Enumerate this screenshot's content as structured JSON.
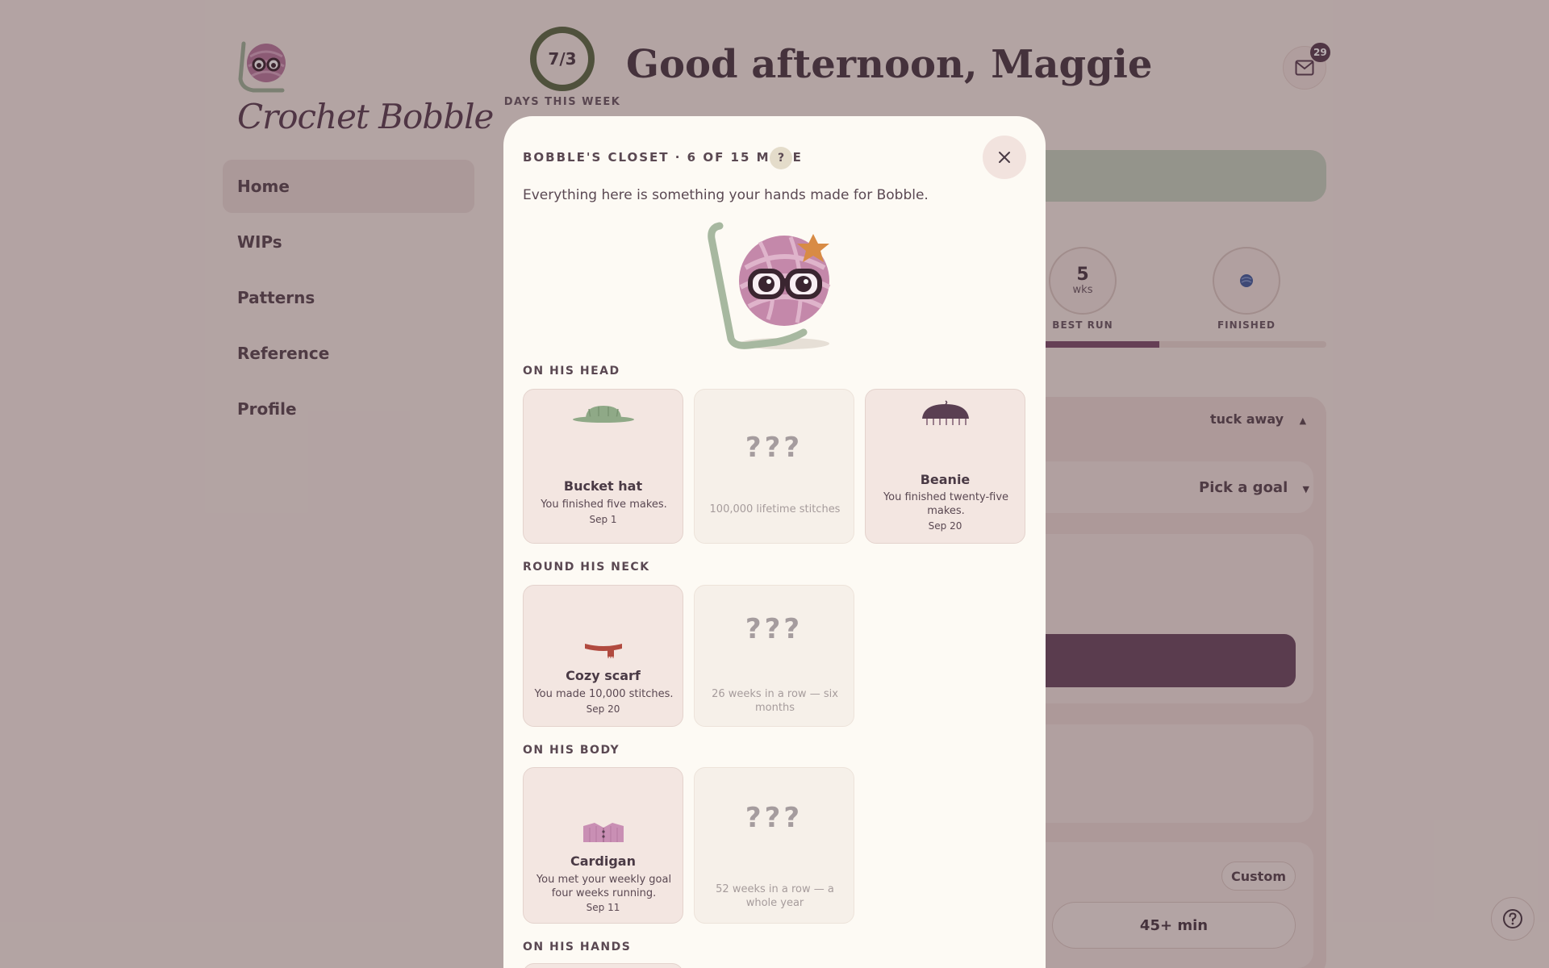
{
  "brand": {
    "name": "Crochet Bobble",
    "logo_icon": "yarn-ball-glasses-icon"
  },
  "nav": {
    "items": [
      {
        "label": "Home",
        "active": true
      },
      {
        "label": "WIPs"
      },
      {
        "label": "Patterns"
      },
      {
        "label": "Reference"
      },
      {
        "label": "Profile"
      }
    ]
  },
  "header": {
    "days_ring": {
      "text": "7/3",
      "label": "DAYS THIS WEEK"
    },
    "greeting": "Good afternoon, Maggie",
    "mail": {
      "icon": "mail-icon",
      "badge": "29"
    }
  },
  "background": {
    "best_run": {
      "value": "5",
      "unit": "wks",
      "label": "BEST RUN"
    },
    "finished": {
      "label": "FINISHED",
      "icon": "yarn-ball-icon"
    },
    "progress_fraction": 0.5,
    "tuck_away": "tuck away",
    "tuck_icon": "caret-up-icon",
    "pick_goal": "Pick a goal",
    "pick_icon": "caret-down-icon",
    "custom": "Custom",
    "min_option": "45+ min",
    "help_icon": "help-circle-icon"
  },
  "closet": {
    "title": "BOBBLE'S CLOSET · 6 OF 15 MADE",
    "help": "?",
    "close_icon": "close-icon",
    "subtitle": "Everything here is something your hands made for Bobble.",
    "sections": {
      "head": {
        "label": "ON HIS HEAD",
        "items": [
          {
            "name": "Bucket hat",
            "desc": "You finished five makes.",
            "date": "Sep 1",
            "icon": "bucket-hat-icon"
          },
          {
            "locked": "???",
            "hint": "100,000 lifetime stitches"
          },
          {
            "name": "Beanie",
            "desc": "You finished twenty-five makes.",
            "date": "Sep 20",
            "icon": "beanie-icon"
          }
        ]
      },
      "neck": {
        "label": "ROUND HIS NECK",
        "items": [
          {
            "name": "Cozy scarf",
            "desc": "You made 10,000 stitches.",
            "date": "Sep 20",
            "icon": "scarf-icon"
          },
          {
            "locked": "???",
            "hint": "26 weeks in a row — six months"
          }
        ]
      },
      "body": {
        "label": "ON HIS BODY",
        "items": [
          {
            "name": "Cardigan",
            "desc": "You met your weekly goal four weeks running.",
            "date": "Sep 11",
            "icon": "cardigan-icon"
          },
          {
            "locked": "???",
            "hint": "52 weeks in a row — a whole year"
          }
        ]
      },
      "hands": {
        "label": "ON HIS HANDS"
      }
    }
  },
  "colors": {
    "plum": "#5a3f52",
    "accent_plum": "#7c4f6c",
    "sage": "#9fb49a",
    "ring_green": "#5a6b45",
    "overlay": "rgba(60,35,45,0.36)"
  }
}
